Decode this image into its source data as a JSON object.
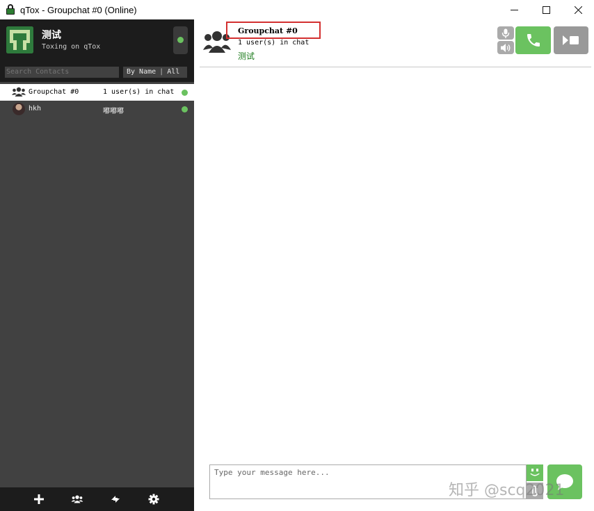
{
  "window": {
    "title": "qTox - Groupchat #0 (Online)",
    "controls": {
      "minimize": "—",
      "maximize": "☐",
      "close": "✕"
    }
  },
  "profile": {
    "name": "测试",
    "status_message": "Toxing on qTox",
    "status": "online"
  },
  "search": {
    "placeholder": "Search Contacts"
  },
  "filter": {
    "sort_label": "By Name",
    "scope_label": "All",
    "separator": "|"
  },
  "contacts": [
    {
      "name": "Groupchat #0",
      "subtitle": "1 user(s) in chat",
      "status": "online",
      "type": "group",
      "active": true
    },
    {
      "name": "hkh",
      "subtitle": "嘟嘟嘟",
      "status": "online",
      "type": "friend",
      "active": false
    }
  ],
  "chat": {
    "title": "Groupchat #0",
    "subtitle": "1 user(s) in chat",
    "topic": "测试"
  },
  "composer": {
    "placeholder": "Type your message here..."
  },
  "watermark": "知乎 @scq2021",
  "colors": {
    "accent_green": "#6bc260",
    "dark_panel": "#1c1c1c",
    "contact_list_bg": "#414141",
    "highlight_red": "#d32f2f",
    "topic_green": "#1a7a1a"
  },
  "icons": {
    "bottom_bar": [
      "add-friend-icon",
      "create-group-icon",
      "transfer-icon",
      "settings-icon"
    ]
  }
}
